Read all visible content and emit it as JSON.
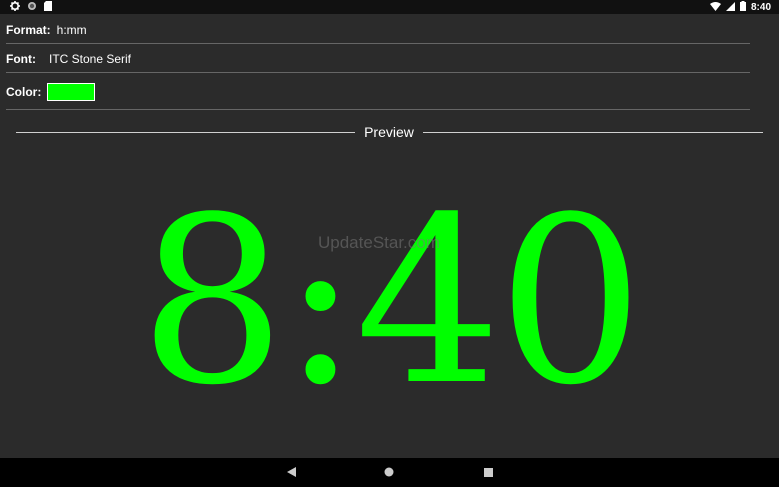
{
  "status_bar": {
    "left_icons": [
      "gear-icon",
      "circle-icon",
      "sd-card-icon"
    ],
    "right_icons": [
      "wifi-icon",
      "signal-icon",
      "battery-icon"
    ],
    "time": "8:40"
  },
  "settings": {
    "format": {
      "label": "Format:",
      "value": "h:mm"
    },
    "font": {
      "label": "Font:",
      "value": "ITC Stone Serif"
    },
    "color": {
      "label": "Color:",
      "value": "#00ff00"
    }
  },
  "preview": {
    "label": "Preview",
    "clock_text": "8:40",
    "clock_color": "#00ff00"
  },
  "watermark": "UpdateStar.com",
  "nav_bar": {
    "buttons": [
      "back-icon",
      "home-icon",
      "recents-icon"
    ]
  }
}
